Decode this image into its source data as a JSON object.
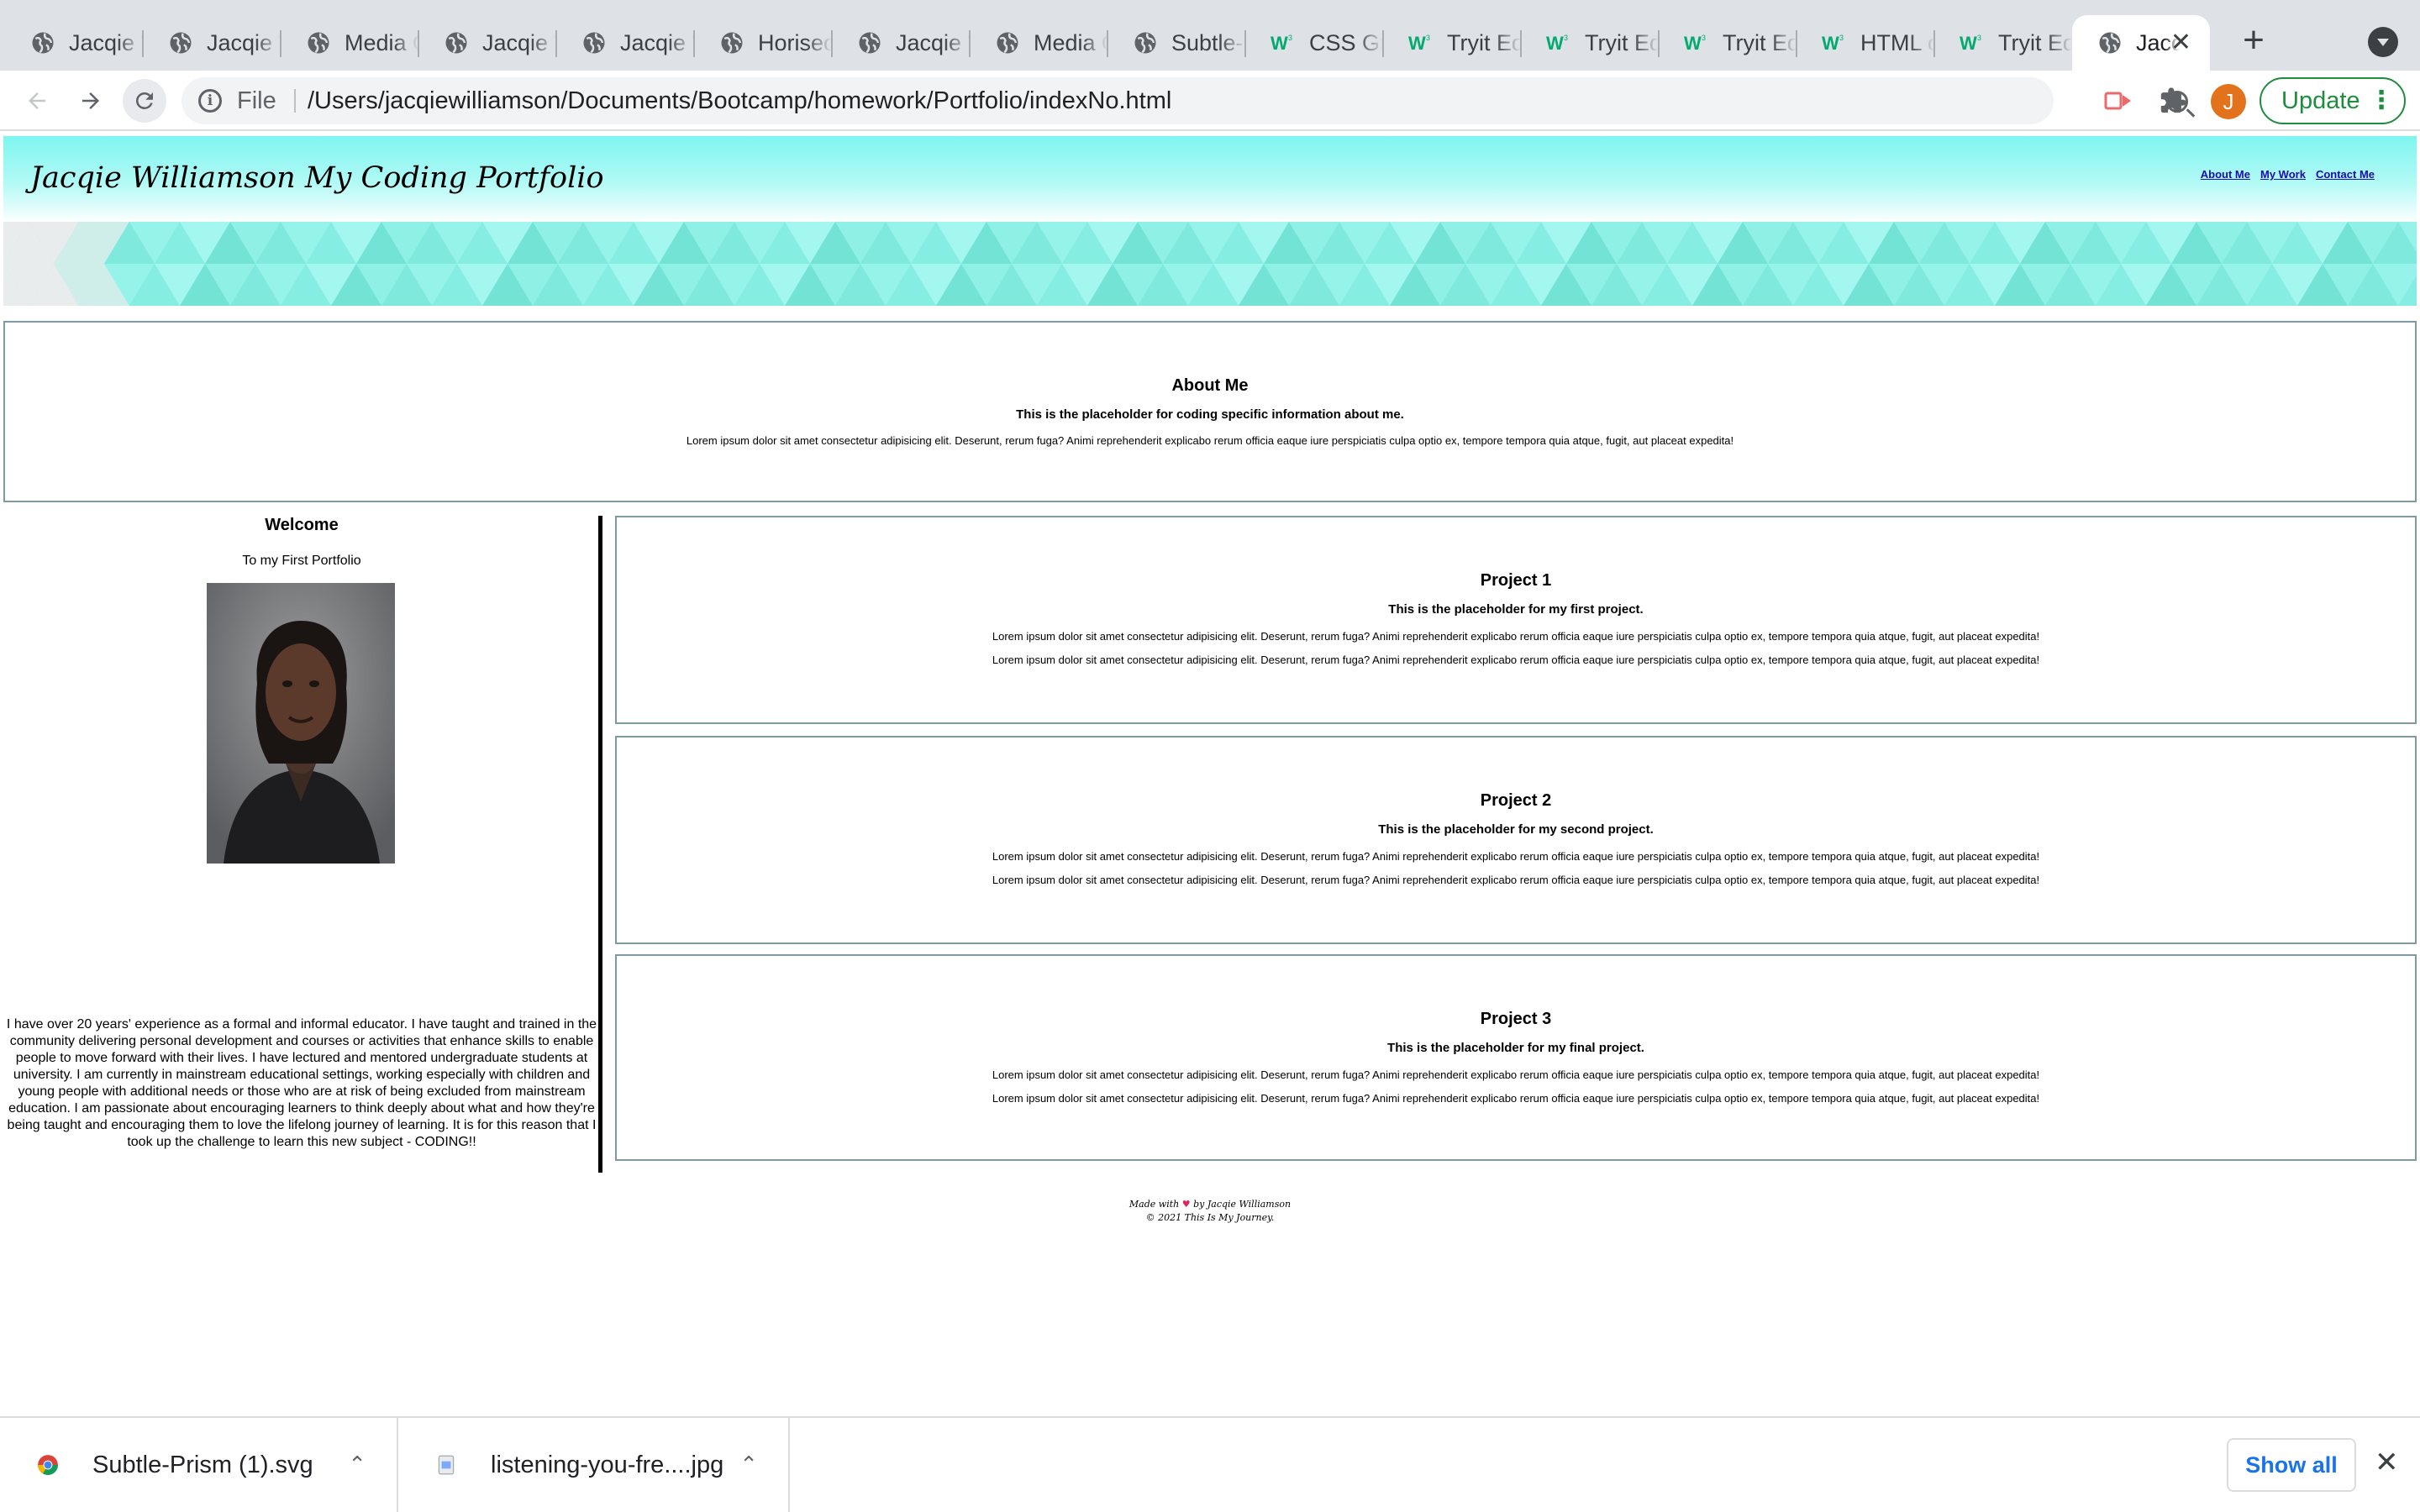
{
  "browser": {
    "tabs": [
      {
        "title": "Jacqie Williamson",
        "icon": "globe-icon"
      },
      {
        "title": "Jacqie Williamson",
        "icon": "globe-icon"
      },
      {
        "title": "Media Queries",
        "icon": "globe-icon"
      },
      {
        "title": "Jacqie Williamson",
        "icon": "globe-icon"
      },
      {
        "title": "Jacqie Williamson",
        "icon": "globe-icon"
      },
      {
        "title": "Horiseon",
        "icon": "globe-icon"
      },
      {
        "title": "Jacqie Williamson",
        "icon": "globe-icon"
      },
      {
        "title": "Media Queries",
        "icon": "globe-icon"
      },
      {
        "title": "Subtle-Prism",
        "icon": "globe-icon"
      },
      {
        "title": "CSS Grid",
        "icon": "w3schools-icon"
      },
      {
        "title": "Tryit Editor",
        "icon": "w3schools-icon"
      },
      {
        "title": "Tryit Editor",
        "icon": "w3schools-icon"
      },
      {
        "title": "Tryit Editor",
        "icon": "w3schools-icon"
      },
      {
        "title": "HTML colors",
        "icon": "w3schools-icon"
      },
      {
        "title": "Tryit Editor",
        "icon": "w3schools-icon"
      },
      {
        "title": "Jacqie Williamson",
        "icon": "globe-icon",
        "active": true
      }
    ],
    "address": {
      "scheme": "File",
      "url": "/Users/jacqiewilliamson/Documents/Bootcamp/homework/Portfolio/indexNo.html"
    },
    "profile_initial": "J",
    "update_label": "Update",
    "colors": {
      "update_green": "#1e8e3e",
      "profile_orange": "#e2721b",
      "link_blue": "#1a73e8"
    }
  },
  "site": {
    "title": "Jacqie Williamson My Coding Portfolio",
    "nav": [
      "About Me",
      "My Work",
      "Contact Me"
    ],
    "about": {
      "heading": "About Me",
      "subheading": "This is the placeholder for coding specific information about me.",
      "text": "Lorem ipsum dolor sit amet consectetur adipisicing elit. Deserunt, rerum fuga? Animi reprehenderit explicabo rerum officia eaque iure perspiciatis culpa optio ex, tempore tempora quia atque, fugit, aut placeat expedita!"
    },
    "sidebar": {
      "heading": "Welcome",
      "subheading": "To my First Portfolio",
      "bio": "I have over 20 years' experience as a formal and informal educator. I have taught and trained in the community delivering personal development and courses or activities that enhance skills to enable people to move forward with their lives. I have lectured and mentored undergraduate students at university. I am currently in mainstream educational settings, working especially with children and young people with additional needs or those who are at risk of being excluded from mainstream education. I am passionate about encouraging learners to think deeply about what and how they're being taught and encouraging them to love the lifelong journey of learning. It is for this reason that I took up the challenge to learn this new subject - CODING!!"
    },
    "projects": [
      {
        "heading": "Project 1",
        "subheading": "This is the placeholder for my first project.",
        "line1": "Lorem ipsum dolor sit amet consectetur adipisicing elit. Deserunt, rerum fuga? Animi reprehenderit explicabo rerum officia eaque iure perspiciatis culpa optio ex, tempore tempora quia atque, fugit, aut placeat expedita!",
        "line2": "Lorem ipsum dolor sit amet consectetur adipisicing elit. Deserunt, rerum fuga? Animi reprehenderit explicabo rerum officia eaque iure perspiciatis culpa optio ex, tempore tempora quia atque, fugit, aut placeat expedita!"
      },
      {
        "heading": "Project 2",
        "subheading": "This is the placeholder for my second project.",
        "line1": "Lorem ipsum dolor sit amet consectetur adipisicing elit. Deserunt, rerum fuga? Animi reprehenderit explicabo rerum officia eaque iure perspiciatis culpa optio ex, tempore tempora quia atque, fugit, aut placeat expedita!",
        "line2": "Lorem ipsum dolor sit amet consectetur adipisicing elit. Deserunt, rerum fuga? Animi reprehenderit explicabo rerum officia eaque iure perspiciatis culpa optio ex, tempore tempora quia atque, fugit, aut placeat expedita!"
      },
      {
        "heading": "Project 3",
        "subheading": "This is the placeholder for my final project.",
        "line1": "Lorem ipsum dolor sit amet consectetur adipisicing elit. Deserunt, rerum fuga? Animi reprehenderit explicabo rerum officia eaque iure perspiciatis culpa optio ex, tempore tempora quia atque, fugit, aut placeat expedita!",
        "line2": "Lorem ipsum dolor sit amet consectetur adipisicing elit. Deserunt, rerum fuga? Animi reprehenderit explicabo rerum officia eaque iure perspiciatis culpa optio ex, tempore tempora quia atque, fugit, aut placeat expedita!"
      }
    ],
    "footer": {
      "made_prefix": "Made with",
      "made_suffix": "by Jacqie Williamson",
      "copyright": "© 2021 This Is My Journey."
    },
    "colors": {
      "header_cyan": "#7ff5f0",
      "prism_teal": "#8ef0e6",
      "border": "#7f9aa3"
    }
  },
  "downloads": {
    "items": [
      {
        "name": "Subtle-Prism (1).svg",
        "icon": "chrome-file-icon"
      },
      {
        "name": "listening-you-fre....jpg",
        "icon": "image-file-icon"
      }
    ],
    "show_all": "Show all"
  }
}
